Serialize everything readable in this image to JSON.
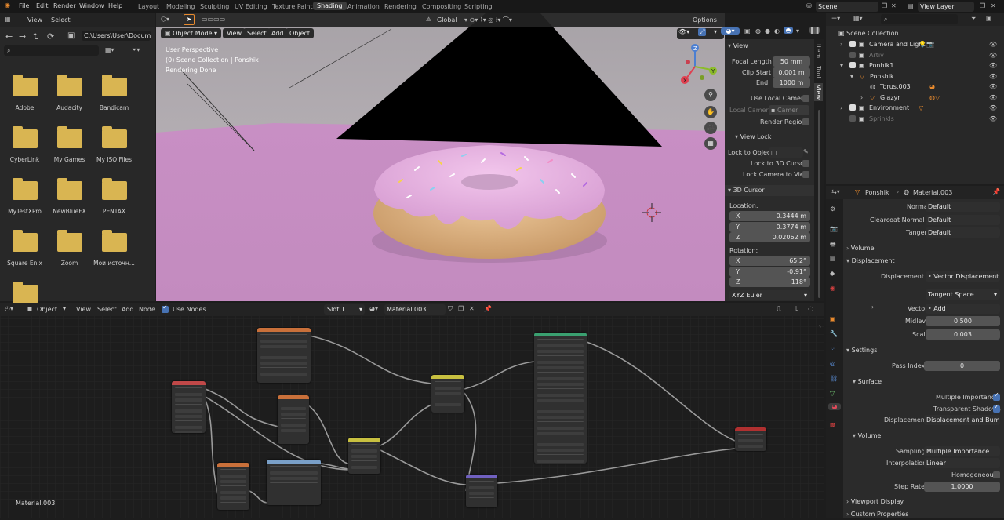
{
  "menu": [
    "File",
    "Edit",
    "Render",
    "Window",
    "Help"
  ],
  "workspaces": [
    "Layout",
    "Modeling",
    "Sculpting",
    "UV Editing",
    "Texture Paint",
    "Shading",
    "Animation",
    "Rendering",
    "Compositing",
    "Scripting"
  ],
  "active_workspace": "Shading",
  "scene": "Scene",
  "view_layer": "View Layer",
  "filebrowser": {
    "view_label": "View",
    "select_label": "Select",
    "path": "C:\\Users\\User\\Docume...",
    "folders": [
      "Adobe",
      "Audacity",
      "Bandicam",
      "CyberLink",
      "My Games",
      "My ISO Files",
      "MyTestXPro",
      "NewBlueFX",
      "PENTAX",
      "Square Enix",
      "Zoom",
      "Мои источн..."
    ]
  },
  "viewport": {
    "transform": "Global",
    "options": "Options",
    "mode": "Object Mode",
    "menus": [
      "View",
      "Select",
      "Add",
      "Object"
    ],
    "overlay_line1": "User Perspective",
    "overlay_line2": "(0) Scene Collection | Ponshik",
    "overlay_line3": "Rendering Done"
  },
  "npanel": {
    "tabs": [
      "Item",
      "Tool",
      "View"
    ],
    "view_title": "View",
    "focal_length_label": "Focal Length",
    "focal_length": "50 mm",
    "clip_start_label": "Clip Start",
    "clip_start": "0.001 m",
    "end_label": "End",
    "end": "1000 m",
    "use_local_camera": "Use Local Camera",
    "local_camera": "Local Camera",
    "camera_field": "Camer",
    "render_region": "Render Region",
    "view_lock": "View Lock",
    "lock_to_object": "Lock to Objec",
    "lock_3d_cursor": "Lock to 3D Cursor",
    "lock_camera_view": "Lock Camera to View",
    "cursor_title": "3D Cursor",
    "location": "Location:",
    "loc_x": "0.3444 m",
    "loc_y": "0.3774 m",
    "loc_z": "0.02062 m",
    "rotation": "Rotation:",
    "rot_x": "65.2°",
    "rot_y": "-0.91°",
    "rot_z": "118°",
    "rotation_mode": "XYZ Euler",
    "x": "X",
    "y": "Y",
    "z": "Z"
  },
  "outliner": {
    "title": "Scene Collection",
    "items": [
      "Camera and Light",
      "Artiv",
      "Ponhik1",
      "Ponshik",
      "Torus.003",
      "Glazyr",
      "Environment",
      "Sprinkls"
    ]
  },
  "properties": {
    "object": "Ponshik",
    "material": "Material.003",
    "normal_label": "Normal",
    "normal": "Default",
    "clearcoat_label": "Clearcoat Normal",
    "clearcoat": "Default",
    "tangent_label": "Tangent",
    "tangent": "Default",
    "volume": "Volume",
    "displacement_head": "Displacement",
    "displacement_label": "Displacement",
    "displacement_val": "Vector Displacement",
    "space": "Tangent Space",
    "vector_label": "Vector",
    "vector_val": "Add",
    "midlevel_label": "Midlevel",
    "midlevel": "0.500",
    "scale_label": "Scale",
    "scale": "0.003",
    "settings": "Settings",
    "pass_index_label": "Pass Index",
    "pass_index": "0",
    "surface": "Surface",
    "multiple_importance": "Multiple Importance",
    "transparent_shadows": "Transparent Shadows",
    "displacement_method_label": "Displacement",
    "displacement_method": "Displacement and Bump",
    "volume2": "Volume",
    "sampling_label": "Sampling",
    "sampling": "Multiple Importance",
    "interpolation_label": "Interpolation",
    "interpolation": "Linear",
    "homogeneous": "Homogeneous",
    "step_rate_label": "Step Rate",
    "step_rate": "1.0000",
    "viewport_display": "Viewport Display",
    "custom_properties": "Custom Properties"
  },
  "nodeeditor": {
    "editor": "Object",
    "menus": [
      "View",
      "Select",
      "Add",
      "Node"
    ],
    "use_nodes": "Use Nodes",
    "slot": "Slot 1",
    "material": "Material.003",
    "footer": "Material.003"
  },
  "colors": {
    "accent": "#4772b3",
    "header": "#232323",
    "folder": "#d9b552",
    "viewport_floor": "#c48ac0"
  }
}
